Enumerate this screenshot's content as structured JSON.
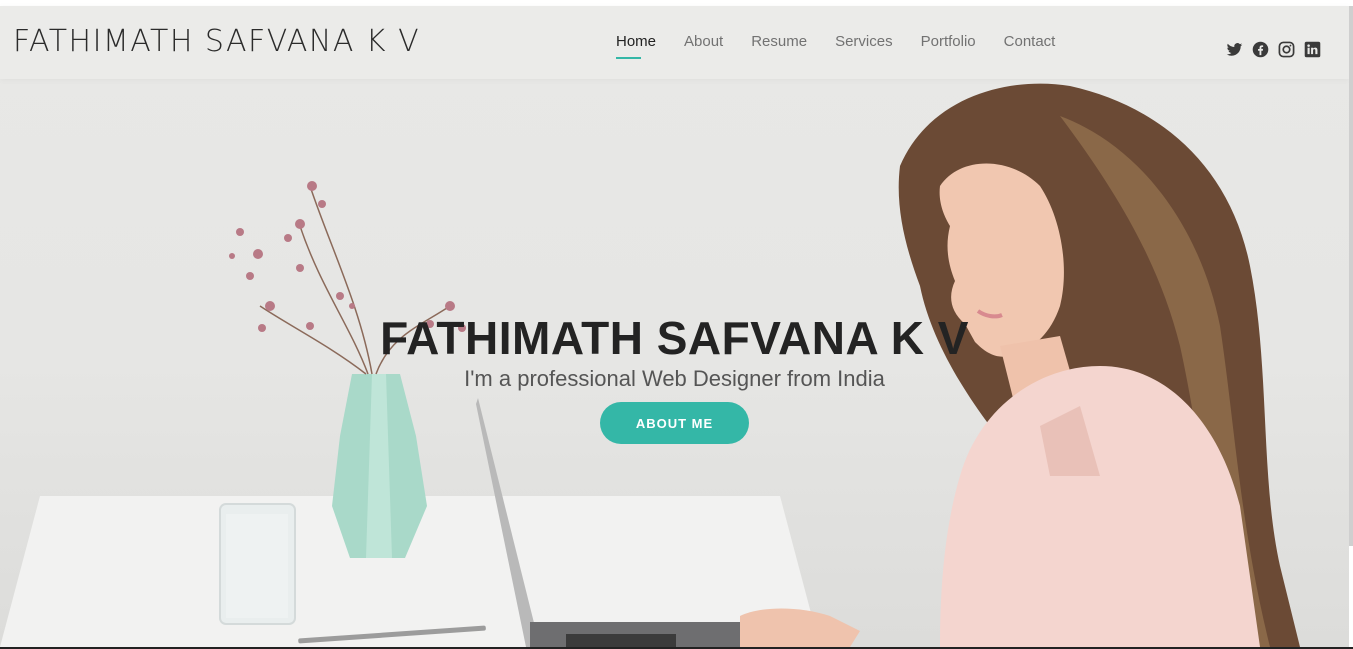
{
  "header": {
    "logo": "FATHIMATH SAFVANA K V",
    "nav": [
      {
        "label": "Home",
        "active": true
      },
      {
        "label": "About",
        "active": false
      },
      {
        "label": "Resume",
        "active": false
      },
      {
        "label": "Services",
        "active": false
      },
      {
        "label": "Portfolio",
        "active": false
      },
      {
        "label": "Contact",
        "active": false
      }
    ],
    "social": [
      "twitter-icon",
      "facebook-icon",
      "instagram-icon",
      "linkedin-icon"
    ]
  },
  "hero": {
    "title": "FATHIMATH SAFVANA K V",
    "subtitle": "I'm a professional Web Designer from India",
    "button_label": "ABOUT ME"
  },
  "colors": {
    "accent": "#34b7a7",
    "text_dark": "#232323",
    "nav_text": "#727272",
    "header_bg": "#eaeae8"
  }
}
